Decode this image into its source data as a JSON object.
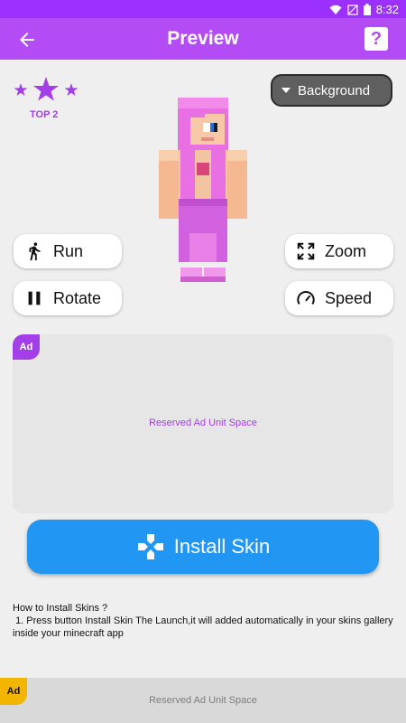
{
  "status_bar": {
    "time": "8:32"
  },
  "app_bar": {
    "title": "Preview",
    "help_label": "?"
  },
  "rank": {
    "label": "TOP 2"
  },
  "background_button": {
    "label": "Background"
  },
  "controls": {
    "run_label": "Run",
    "rotate_label": "Rotate",
    "zoom_label": "Zoom",
    "speed_label": "Speed"
  },
  "ad_unit": {
    "badge": "Ad",
    "text": "Reserved Ad Unit Space"
  },
  "install": {
    "label": "Install Skin"
  },
  "instructions": {
    "title": "How to Install Skins ?",
    "step1": " 1. Press button Install Skin The Launch,it will added automatically in your skins gallery inside your minecraft app"
  },
  "bottom_ad": {
    "badge": "Ad",
    "text": "Reserved Ad Unit Space"
  },
  "colors": {
    "accent": "#b44cf6",
    "install": "#2196f3",
    "ad_text": "#a43ee8"
  }
}
